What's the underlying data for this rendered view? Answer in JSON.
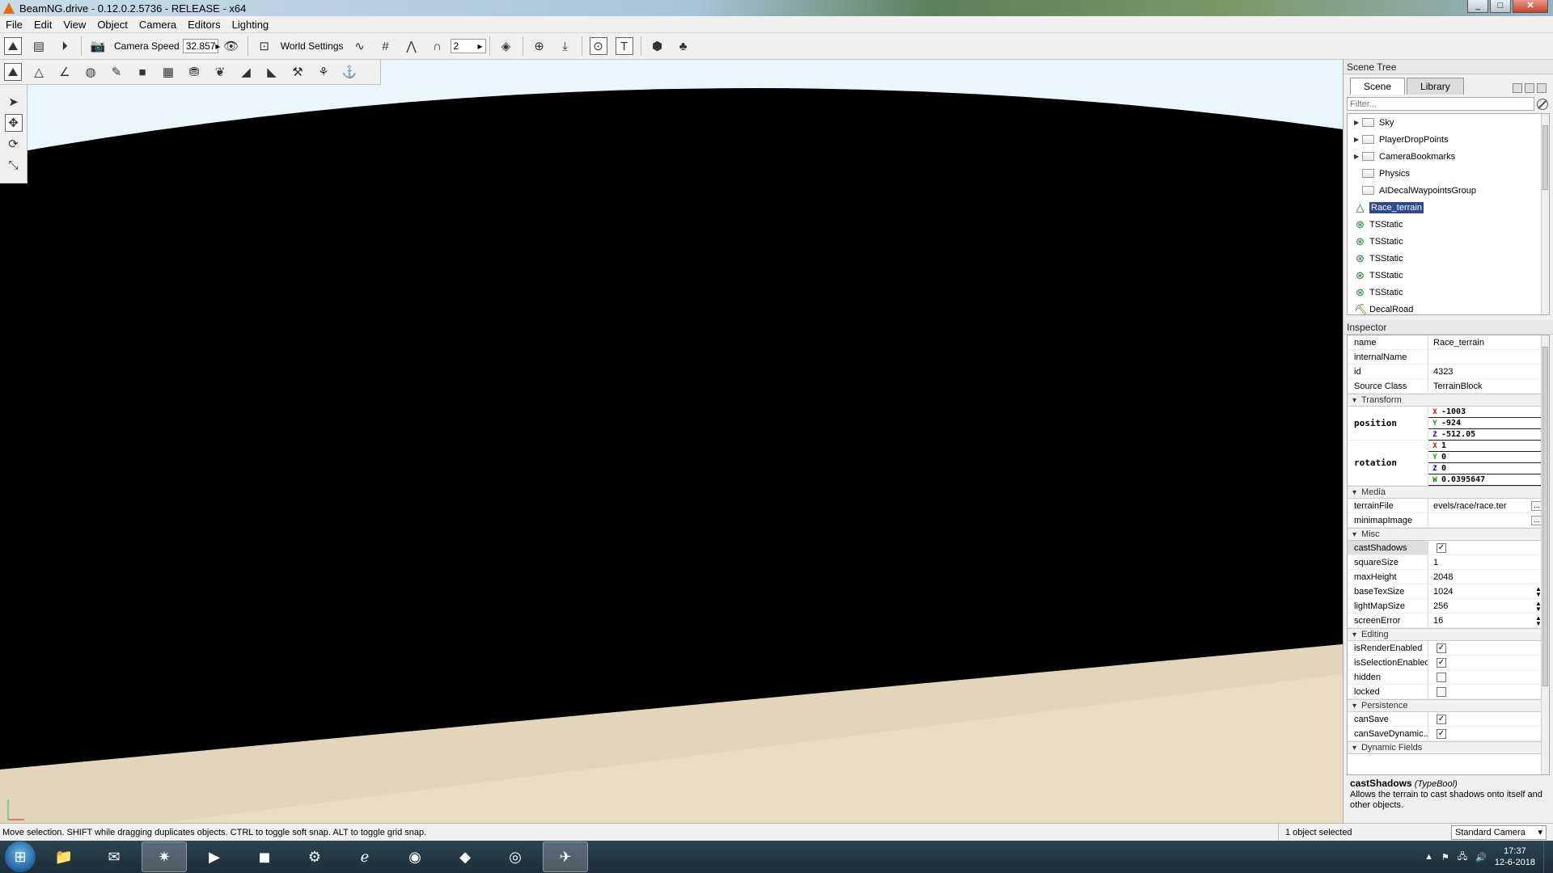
{
  "window": {
    "title": "BeamNG.drive - 0.12.0.2.5736 - RELEASE - x64",
    "min": "_",
    "max": "□",
    "close": "✕"
  },
  "menu": [
    "File",
    "Edit",
    "View",
    "Object",
    "Camera",
    "Editors",
    "Lighting"
  ],
  "toolbar": {
    "camera_speed_label": "Camera Speed",
    "camera_speed_value": "32.857",
    "world_settings_label": "World Settings",
    "grid_value": "2"
  },
  "scene_tree": {
    "title": "Scene Tree",
    "tabs": [
      "Scene",
      "Library"
    ],
    "filter_placeholder": "Filter...",
    "items": [
      {
        "label": "Sky",
        "kind": "folder",
        "expandable": true
      },
      {
        "label": "PlayerDropPoints",
        "kind": "folder",
        "expandable": true
      },
      {
        "label": "CameraBookmarks",
        "kind": "folder",
        "expandable": true
      },
      {
        "label": "Physics",
        "kind": "folder",
        "expandable": false
      },
      {
        "label": "AIDecalWaypointsGroup",
        "kind": "folder",
        "expandable": false
      },
      {
        "label": "Race_terrain",
        "kind": "terrain",
        "selected": true
      },
      {
        "label": "TSStatic",
        "kind": "static"
      },
      {
        "label": "TSStatic",
        "kind": "static"
      },
      {
        "label": "TSStatic",
        "kind": "static"
      },
      {
        "label": "TSStatic",
        "kind": "static"
      },
      {
        "label": "TSStatic",
        "kind": "static"
      },
      {
        "label": "DecalRoad",
        "kind": "road"
      }
    ]
  },
  "inspector": {
    "title": "Inspector",
    "fields": [
      {
        "k": "name",
        "v": "Race_terrain"
      },
      {
        "k": "internalName",
        "v": ""
      },
      {
        "k": "id",
        "v": "4323"
      },
      {
        "k": "Source Class",
        "v": "TerrainBlock"
      }
    ],
    "groups": {
      "transform": "Transform",
      "media": "Media",
      "misc": "Misc",
      "editing": "Editing",
      "persistence": "Persistence",
      "dynamic": "Dynamic Fields"
    },
    "position": {
      "label": "position",
      "x": "-1003",
      "y": "-924",
      "z": "-512.05"
    },
    "rotation": {
      "label": "rotation",
      "x": "1",
      "y": "0",
      "z": "0",
      "w": "0.0395647"
    },
    "axes": {
      "x": "X",
      "y": "Y",
      "z": "Z",
      "w": "W"
    },
    "media": [
      {
        "k": "terrainFile",
        "v": "evels/race/race.ter"
      },
      {
        "k": "minimapImage",
        "v": ""
      }
    ],
    "misc": {
      "castShadows": "castShadows",
      "rows": [
        {
          "k": "squareSize",
          "v": "1"
        },
        {
          "k": "maxHeight",
          "v": "2048"
        },
        {
          "k": "baseTexSize",
          "v": "1024"
        },
        {
          "k": "lightMapSize",
          "v": "256"
        },
        {
          "k": "screenError",
          "v": "16"
        }
      ]
    },
    "editing": [
      {
        "k": "isRenderEnabled",
        "checked": true
      },
      {
        "k": "isSelectionEnabled",
        "checked": true
      },
      {
        "k": "hidden",
        "checked": false
      },
      {
        "k": "locked",
        "checked": false
      }
    ],
    "persistence": [
      {
        "k": "canSave",
        "checked": true
      },
      {
        "k": "canSaveDynamic...",
        "checked": true
      }
    ],
    "help": {
      "name": "castShadows",
      "type": "(TypeBool)",
      "text": "Allows the terrain to cast shadows onto itself and other objects."
    }
  },
  "status": {
    "message": "Move selection.  SHIFT while dragging duplicates objects.  CTRL to toggle soft snap.  ALT to toggle grid snap.",
    "selection": "1 object selected",
    "camera": "Standard Camera"
  },
  "taskbar": {
    "time": "17:37",
    "date": "12-6-2018"
  },
  "colors": {
    "sky": "#e9f7fd",
    "ground": "#e8dcc5",
    "selection": "#2f4a8a"
  }
}
